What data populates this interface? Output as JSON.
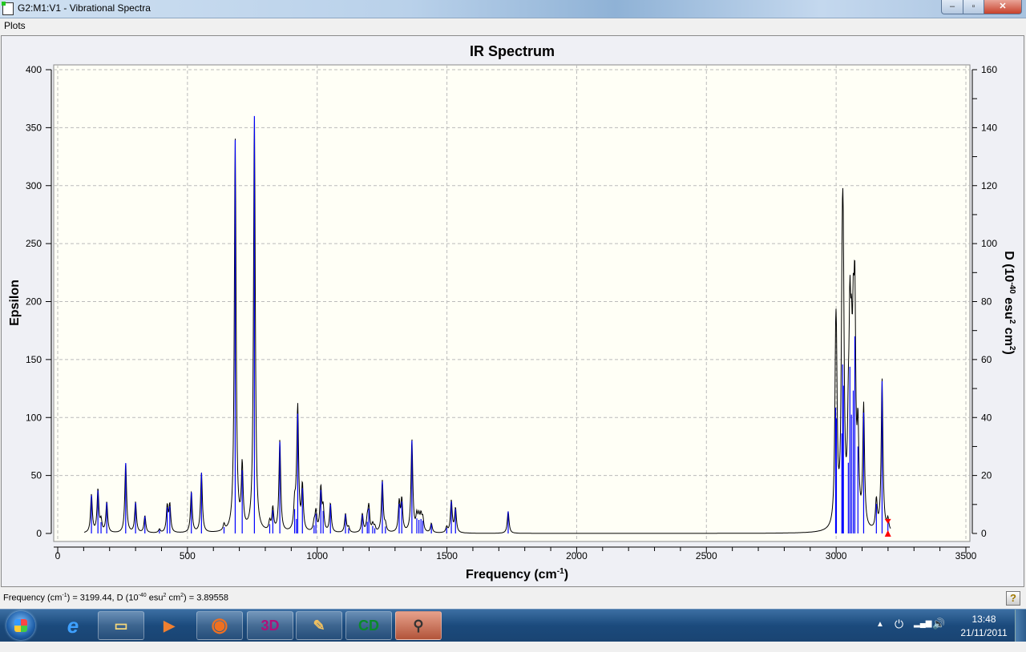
{
  "window": {
    "title": "G2:M1:V1 - Vibrational Spectra",
    "minimize": "–",
    "maximize": "▫",
    "close": "✕"
  },
  "menu": {
    "items": [
      {
        "label": "Plots"
      }
    ]
  },
  "colors": {
    "curve": "#000000",
    "sticks": "#0000ff",
    "marker": "#ff0000",
    "plot_bg": "#fffff6",
    "grid": "#bbbbbb"
  },
  "chart_data": {
    "type": "line",
    "title": "IR Spectrum",
    "xlabel": "Frequency (cm",
    "xlabel_sup": "-1",
    "xlabel_end": ")",
    "ylabel": "Epsilon",
    "y2label": "D (10",
    "y2label_sup1": "-40",
    "y2label_mid": " esu",
    "y2label_sup2": "2",
    "y2label_mid2": " cm",
    "y2label_sup3": "2",
    "y2label_end": ")",
    "xlim": [
      0,
      3500
    ],
    "ylim": [
      0,
      400
    ],
    "y2lim": [
      0,
      160
    ],
    "xticks": [
      "0",
      "500",
      "1000",
      "1500",
      "2000",
      "2500",
      "3000",
      "3500"
    ],
    "yticks": [
      "0",
      "50",
      "100",
      "150",
      "200",
      "250",
      "300",
      "350",
      "400"
    ],
    "y2ticks": [
      "0",
      "20",
      "40",
      "60",
      "80",
      "100",
      "120",
      "140",
      "160"
    ],
    "grid": true,
    "curve_range": [
      100,
      3210
    ],
    "curve_hwhm": 4,
    "epsilon_per_D": 2.5,
    "sticks": {
      "freq": [
        130,
        155,
        167,
        189,
        262,
        300,
        336,
        392,
        422,
        432,
        515,
        554,
        641,
        684,
        711,
        758,
        817,
        829,
        856,
        913,
        920,
        925,
        943,
        988,
        995,
        1014,
        1023,
        1051,
        1109,
        1121,
        1174,
        1193,
        1199,
        1214,
        1222,
        1251,
        1263,
        1316,
        1326,
        1365,
        1384,
        1392,
        1400,
        1407,
        1440,
        1499,
        1517,
        1533,
        1736,
        2998,
        3001,
        3022,
        3025,
        3028,
        3047,
        3053,
        3059,
        3066,
        3072,
        3084,
        3106,
        3155,
        3177,
        3199.44
      ],
      "D": [
        13.1,
        14.8,
        3.9,
        10.6,
        24.3,
        10.6,
        5.9,
        1.2,
        9.0,
        9.4,
        14.2,
        20.9,
        2.2,
        135.7,
        21.8,
        144.0,
        3.2,
        8.0,
        31.6,
        8.4,
        5.0,
        41.3,
        15.6,
        2.8,
        6.8,
        15.0,
        7.8,
        10.0,
        6.5,
        1.8,
        6.4,
        4.0,
        8.6,
        2.6,
        1.8,
        17.9,
        2.4,
        10.2,
        11.0,
        32.0,
        5.2,
        4.7,
        5.0,
        4.4,
        3.2,
        1.9,
        11.0,
        8.4,
        7.6,
        43.4,
        39.7,
        34.5,
        58.3,
        51.0,
        24.4,
        57.5,
        41.0,
        49.3,
        68.0,
        30.0,
        41.7,
        10.2,
        52.5,
        3.9
      ]
    },
    "selected": {
      "freq": 3199.44,
      "D": 3.89558
    }
  },
  "status": {
    "prefix": "Frequency (cm",
    "sup1": "-1",
    "mid": ") = 3199.44, D (10",
    "sup2": "-40",
    "mid2": " esu",
    "sup3": "2",
    "mid3": " cm",
    "sup4": "2",
    "suffix": ") = 3.89558",
    "help": "?"
  },
  "taskbar": {
    "apps": [
      "Internet Explorer",
      "Windows Explorer",
      "Windows Media Player",
      "Firefox",
      "3D app",
      "Paint",
      "CD app",
      "GaussView"
    ],
    "app_glyphs": [
      "e",
      "▭",
      "▶",
      "◉",
      "3D",
      "✎",
      "CD",
      "⚲"
    ],
    "time": "13:48",
    "date": "21/11/2011",
    "tray_icons": [
      "▲",
      "⏻",
      "▂▄▆",
      "🔊"
    ]
  }
}
